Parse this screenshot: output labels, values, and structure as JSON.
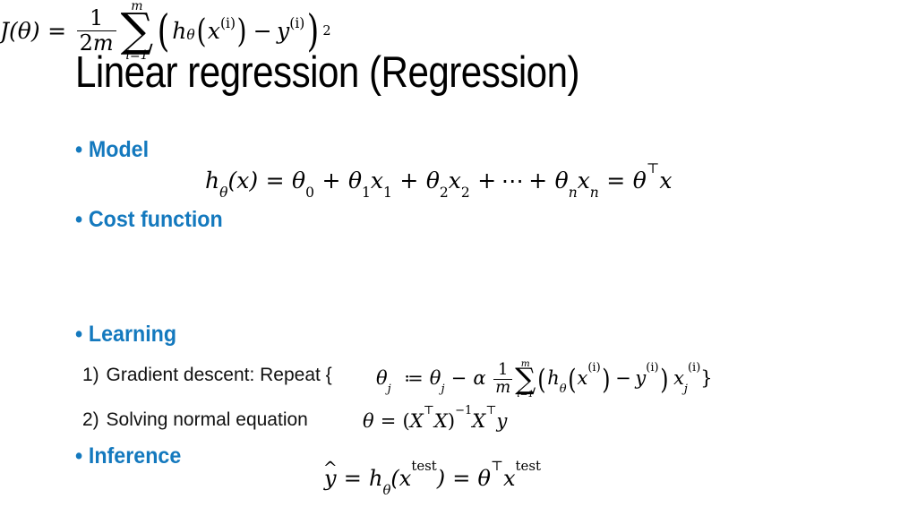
{
  "slide": {
    "background_color": "#FFFFFF",
    "title": "Linear regression (Regression)",
    "accent_color": "#1479BE",
    "text_color": "#000000",
    "bullet_glyph": "•"
  },
  "sections": [
    {
      "id": "model",
      "label": "Model",
      "equation_text": "h_θ(x) = θ_0 + θ_1 x_1 + θ_2 x_2 + ⋯ + θ_n x_n = θ^⊤ x",
      "parts": {
        "h": "h",
        "theta": "θ",
        "x": "x",
        "lparen": "(",
        "rparen": ")",
        "eq": "=",
        "plus": "+",
        "cdots": "⋯",
        "sub0": "0",
        "sub1": "1",
        "sub2": "2",
        "subn": "n",
        "transpose": "⊤"
      }
    },
    {
      "id": "cost_function",
      "label": "Cost function",
      "equation_text": "J(θ) = 1/(2m) Σ_{i=1}^{m} ( h_θ( x^(i) ) − y^(i) )^2",
      "parts": {
        "J": "J",
        "theta": "θ",
        "eq": "=",
        "num": "1",
        "den": "2m",
        "sigma": "∑",
        "lim_top": "m",
        "lim_bot": "i=1",
        "h": "h",
        "x": "x",
        "y": "y",
        "sup_i": "(i)",
        "minus": "−",
        "power": "2",
        "lparen": "(",
        "rparen": ")"
      }
    },
    {
      "id": "learning",
      "label": "Learning",
      "items": [
        {
          "number": "1)",
          "text": "Gradient descent: Repeat {",
          "equation_text": "θ_j ≔ θ_j − α (1/m) Σ_{i=1}^{m} ( h_θ( x^(i) ) − y^(i) ) x_j^(i) }",
          "parts": {
            "theta": "θ",
            "sub_j": "j",
            "assign": "≔",
            "minus": "−",
            "alpha": "α",
            "num": "1",
            "den": "m",
            "sigma": "∑",
            "lim_top": "m",
            "lim_bot": "i=1",
            "h": "h",
            "x": "x",
            "y": "y",
            "sup_i": "(i)",
            "lbrace": "{",
            "rbrace": "}",
            "lparen": "(",
            "rparen": ")"
          }
        },
        {
          "number": "2)",
          "text": "Solving normal equation",
          "equation_text": "θ = (X^⊤ X)^−1 X^⊤ y",
          "parts": {
            "theta": "θ",
            "eq": "=",
            "X": "X",
            "y": "y",
            "transpose": "⊤",
            "inverse": "−1",
            "lparen": "(",
            "rparen": ")"
          }
        }
      ]
    },
    {
      "id": "inference",
      "label": "Inference",
      "equation_text": "ŷ = h_θ( x^test ) = θ^⊤ x^test",
      "parts": {
        "y": "y",
        "hat": "^",
        "eq": "=",
        "h": "h",
        "theta": "θ",
        "x": "x",
        "test": "test",
        "transpose": "⊤",
        "lparen": "(",
        "rparen": ")"
      }
    }
  ]
}
